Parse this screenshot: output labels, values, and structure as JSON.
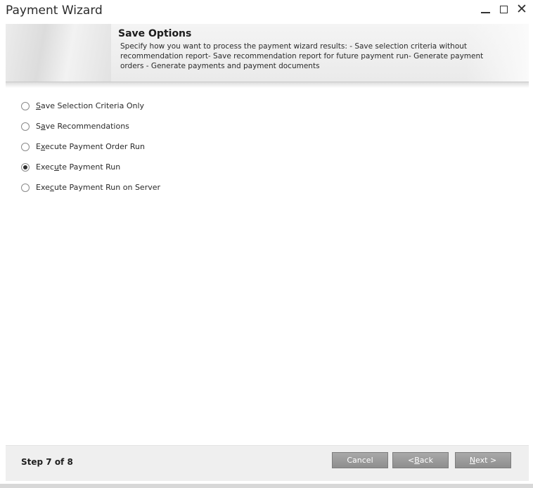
{
  "window": {
    "title": "Payment Wizard",
    "controls": [
      "minimize-icon",
      "maximize-icon",
      "close-icon"
    ]
  },
  "header": {
    "title": "Save Options",
    "description": "Specify how you want to process the payment wizard results: - Save selection criteria without recommendation report- Save recommendation report for future payment run- Generate payment orders - Generate payments and payment documents"
  },
  "options": [
    {
      "pre": "",
      "mnemonic": "S",
      "post": "ave Selection Criteria Only",
      "checked": false
    },
    {
      "pre": "S",
      "mnemonic": "a",
      "post": "ve Recommendations",
      "checked": false
    },
    {
      "pre": "E",
      "mnemonic": "x",
      "post": "ecute Payment Order Run",
      "checked": false
    },
    {
      "pre": "Exec",
      "mnemonic": "u",
      "post": "te Payment Run",
      "checked": true
    },
    {
      "pre": "Exe",
      "mnemonic": "c",
      "post": "ute Payment Run on Server",
      "checked": false
    }
  ],
  "footer": {
    "step": "Step 7 of 8",
    "cancel": "Cancel",
    "back_pre": "< ",
    "back_mnemonic": "B",
    "back_post": "ack",
    "next_mnemonic": "N",
    "next_post": "ext >"
  },
  "colors": {
    "button_bg": "#999999",
    "footer_bg": "#efefef",
    "banner_bg": "#eeeeee"
  }
}
